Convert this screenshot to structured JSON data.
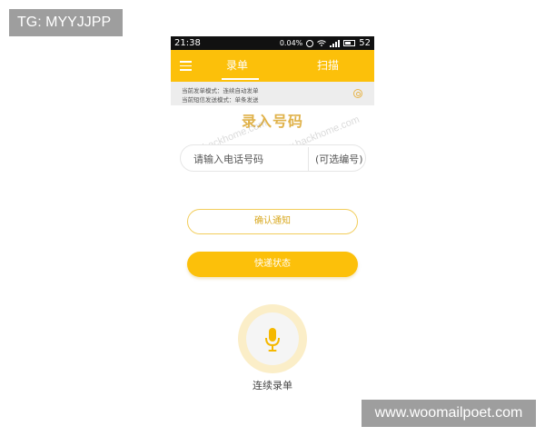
{
  "overlay": {
    "tg_label": "TG: MYYJJPP",
    "site_label": "www.woomailpoet.com"
  },
  "statusbar": {
    "time": "21:38",
    "data_rate": "0.04%",
    "battery": "52",
    "icons": [
      "alarm-icon",
      "wifi-icon",
      "signal-icon",
      "battery-icon"
    ]
  },
  "appbar": {
    "menu_icon": "menu-icon",
    "tabs": [
      {
        "label": "录单",
        "active": true
      },
      {
        "label": "扫描",
        "active": false
      }
    ],
    "color": "#fcc00a"
  },
  "mode_bar": {
    "line1": "当前发单模式：连续自动发单",
    "line2": "当前短信发送模式：单条发送",
    "icon": "gear-icon"
  },
  "main": {
    "heading": "录入号码",
    "watermark": "www.hackhome.com",
    "phone_placeholder": "请输入电话号码",
    "serial_placeholder": "(可选编号)",
    "confirm_button": "确认通知",
    "express_button": "快递状态",
    "mic_icon": "microphone-icon",
    "mic_label": "连续录单"
  },
  "colors": {
    "accent": "#fcc00a",
    "heading": "#e0b24a"
  }
}
